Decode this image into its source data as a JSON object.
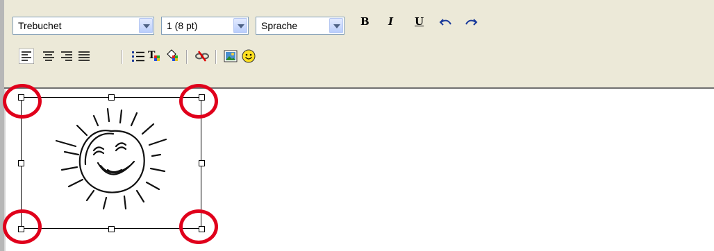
{
  "toolbar": {
    "font_select": {
      "value": "Trebuchet"
    },
    "size_select": {
      "value": "1 (8 pt)"
    },
    "language_select": {
      "value": "Sprache"
    },
    "bold_label": "B",
    "italic_label": "I",
    "underline_label": "U",
    "row2_icons": [
      "align-left-icon",
      "align-center-icon",
      "align-right-icon",
      "align-justify-icon",
      "bullet-list-icon",
      "text-color-icon",
      "background-color-icon",
      "remove-link-icon",
      "insert-image-icon",
      "insert-smiley-icon"
    ]
  },
  "colors": {
    "toolbar_bg": "#ece9d8",
    "highlight_circle": "#e0001b",
    "select_border": "#7f9db9"
  },
  "editor": {
    "image": "sun-drawing",
    "selected": true
  }
}
